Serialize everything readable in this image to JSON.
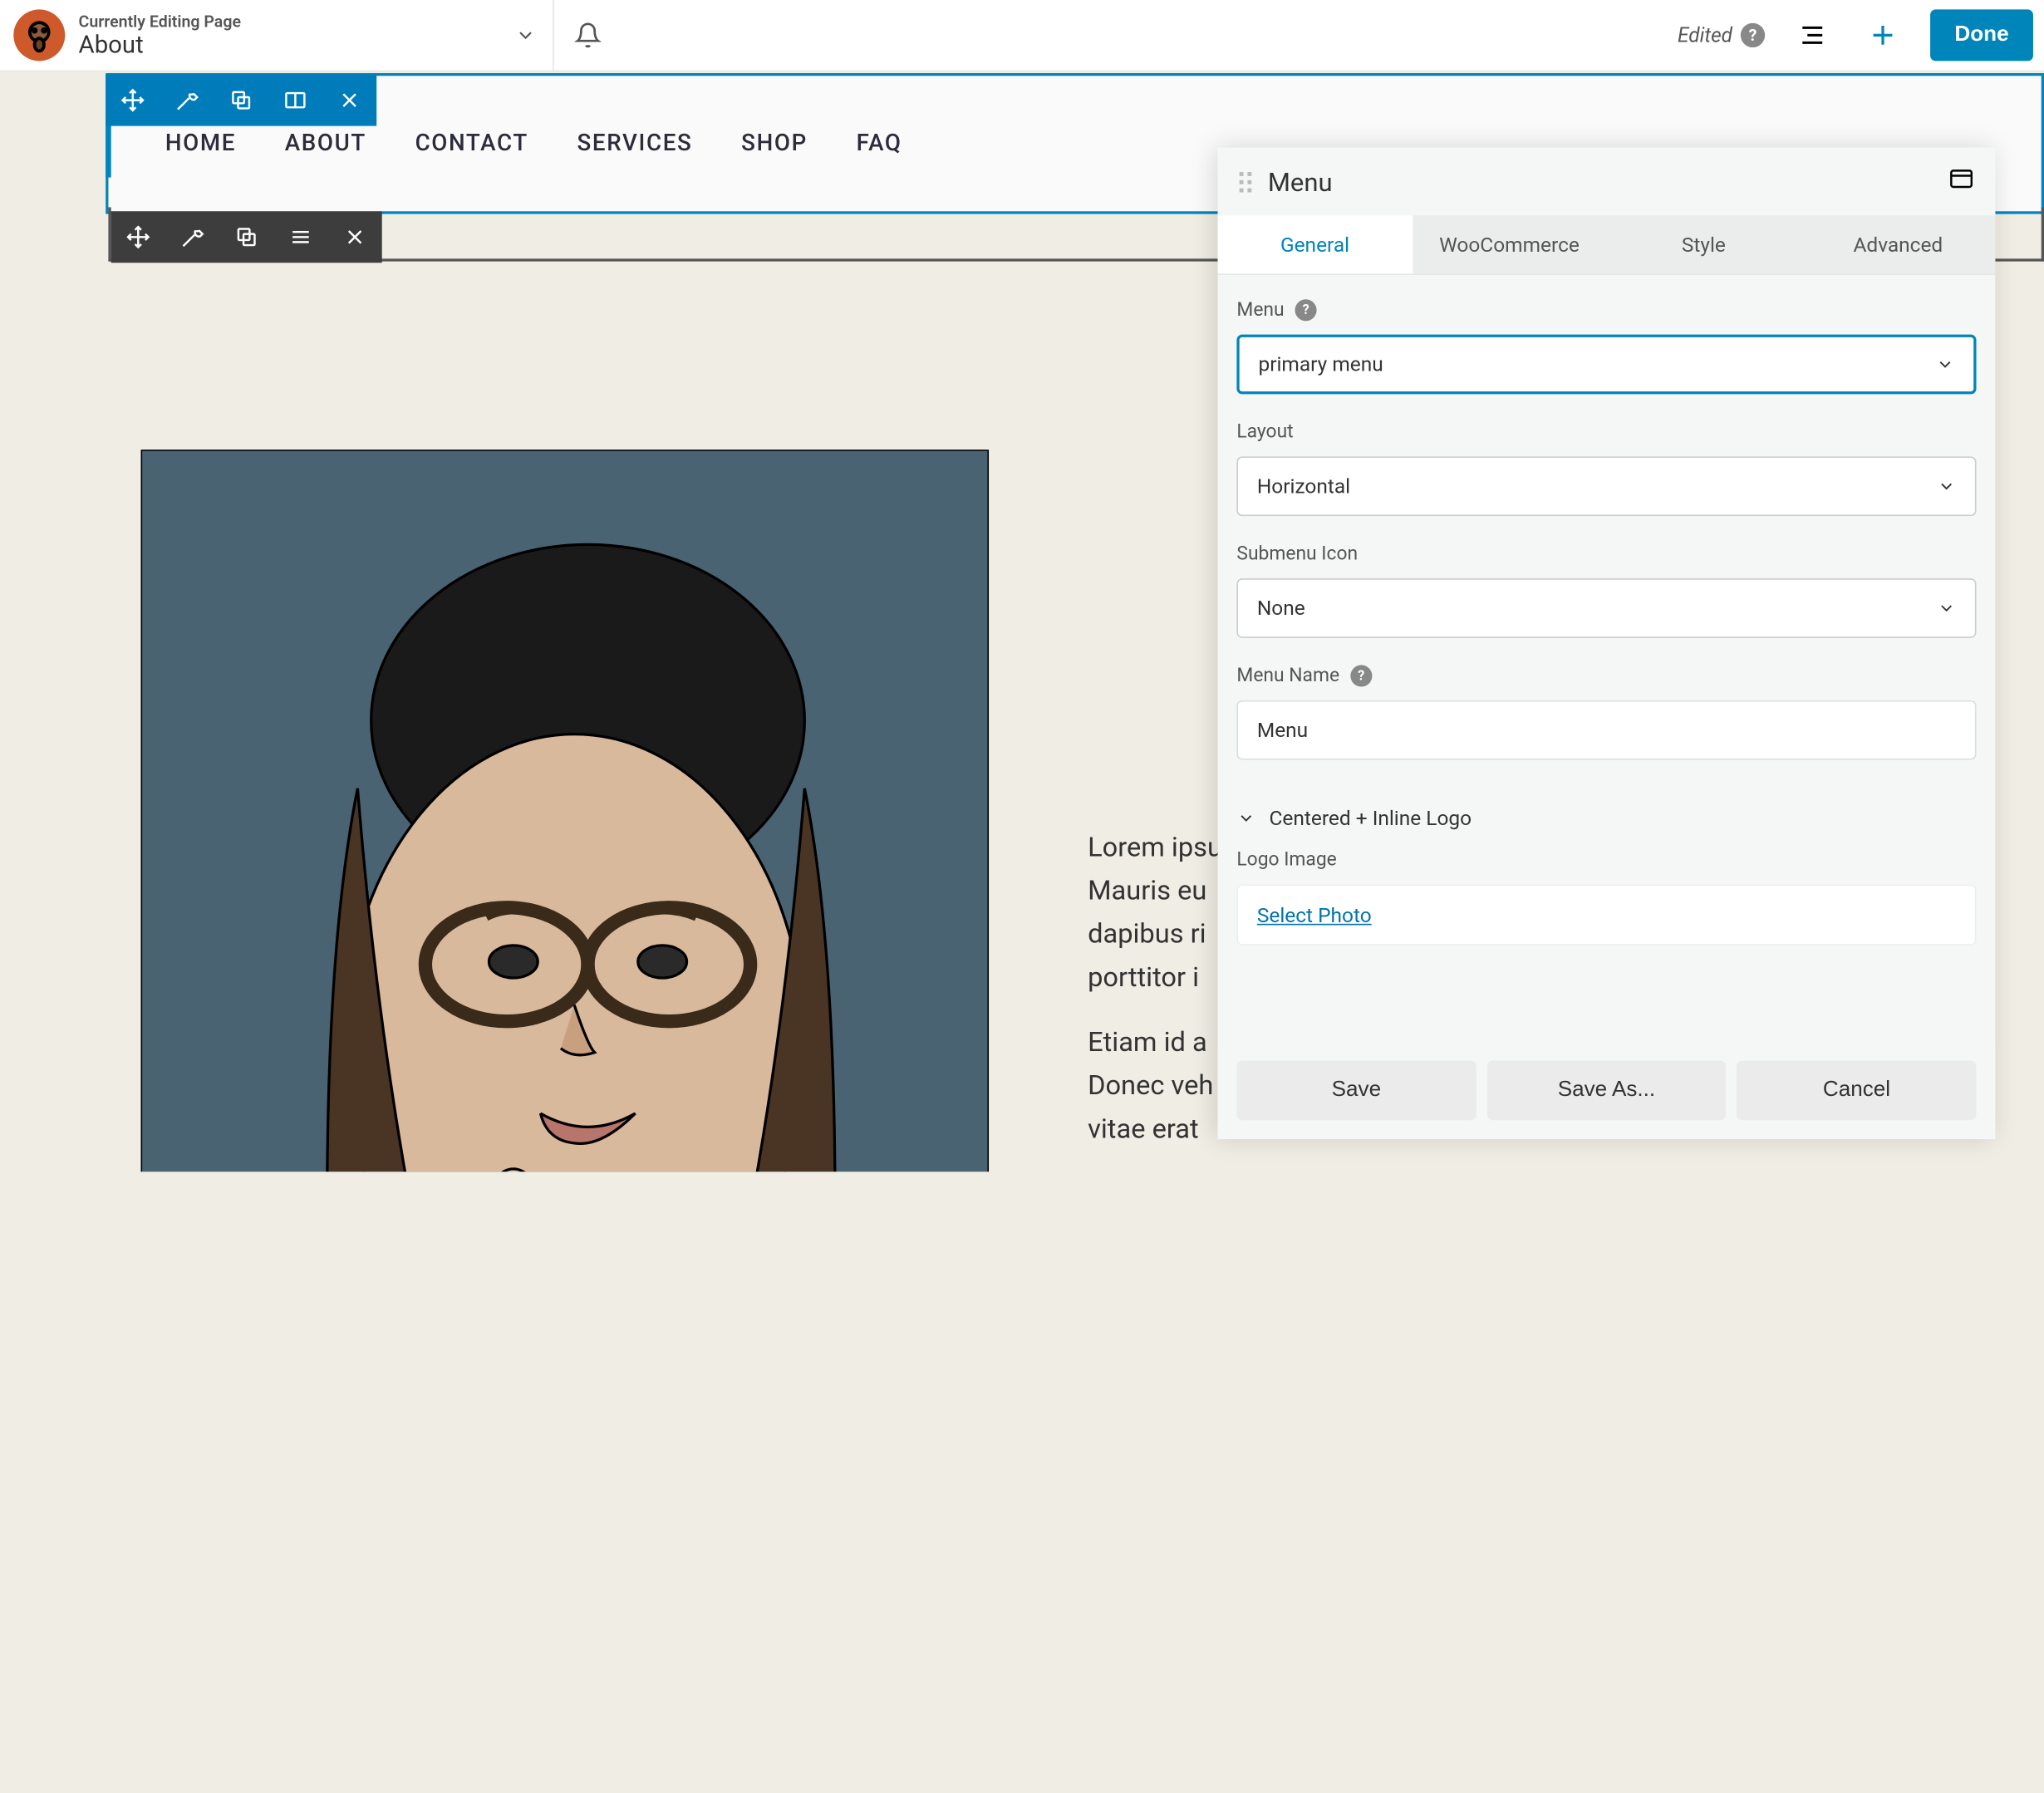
{
  "header": {
    "editing_label": "Currently Editing Page",
    "page_title": "About",
    "edited_label": "Edited",
    "done_label": "Done"
  },
  "nav": {
    "items": [
      "HOME",
      "ABOUT",
      "CONTACT",
      "SERVICES",
      "SHOP",
      "FAQ"
    ]
  },
  "content": {
    "lorem": "Lorem ipsu\nMauris eu\ndapibus ri\nporttitor i",
    "etiam": "Etiam id a\nDonec veh\nvitae erat"
  },
  "sidebar": {
    "title": "Menu",
    "tabs": [
      "General",
      "WooCommerce",
      "Style",
      "Advanced"
    ],
    "active_tab": 0,
    "fields": {
      "menu_label": "Menu",
      "menu_value": "primary menu",
      "layout_label": "Layout",
      "layout_value": "Horizontal",
      "submenu_label": "Submenu Icon",
      "submenu_value": "None",
      "menuname_label": "Menu Name",
      "menuname_value": "Menu",
      "section_label": "Centered + Inline Logo",
      "logoimg_label": "Logo Image",
      "select_photo": "Select Photo"
    },
    "footer": {
      "save": "Save",
      "saveas": "Save As...",
      "cancel": "Cancel"
    }
  }
}
